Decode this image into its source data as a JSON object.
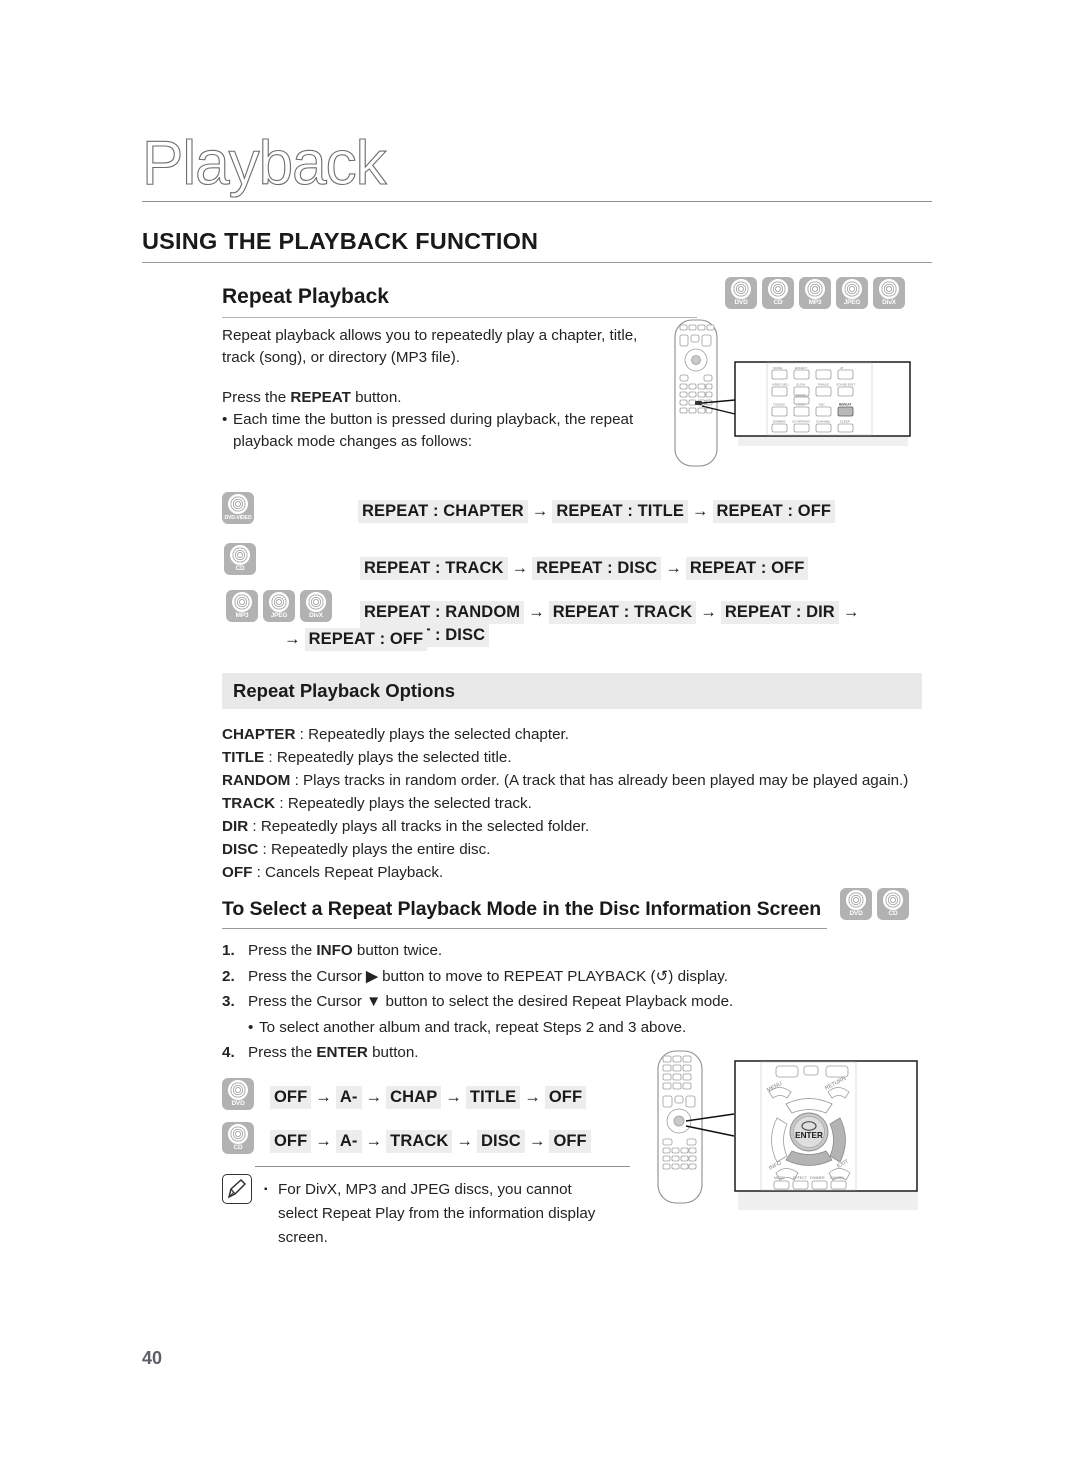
{
  "chapter": {
    "title": "Playback"
  },
  "section": {
    "title": "USING THE PLAYBACK FUNCTION"
  },
  "repeat_playback": {
    "heading": "Repeat Playback",
    "intro_line1": "Repeat playback allows you to repeatedly play a chapter, title,",
    "intro_line2": "track (song), or directory (MP3 file).",
    "press_prefix": "Press the ",
    "press_bold": "REPEAT",
    "press_suffix": " button.",
    "bullet_dot": "•",
    "bullet_line1": "Each time the button is pressed during playback, the repeat",
    "bullet_line2": "playback mode changes as follows:",
    "badges": [
      {
        "label": "DVD",
        "name": "dvd"
      },
      {
        "label": "CD",
        "name": "cd"
      },
      {
        "label": "MP3",
        "name": "mp3"
      },
      {
        "label": "JPEG",
        "name": "jpeg"
      },
      {
        "label": "DivX",
        "name": "divx"
      }
    ]
  },
  "flows": [
    {
      "id": "dvd-video-flow",
      "icons": [
        {
          "label": "DVD-VIDEO",
          "narrow": true
        }
      ],
      "chips": [
        "REPEAT : CHAPTER",
        "REPEAT : TITLE",
        "REPEAT : OFF"
      ],
      "arrow": "→"
    },
    {
      "id": "cd-flow",
      "icons": [
        {
          "label": "CD",
          "narrow": false
        }
      ],
      "chips": [
        "REPEAT : TRACK",
        "REPEAT : DISC",
        "REPEAT : OFF"
      ],
      "arrow": "→"
    },
    {
      "id": "mp3-jpeg-divx-flow",
      "icons": [
        {
          "label": "MP3",
          "narrow": false
        },
        {
          "label": "JPEG",
          "narrow": false
        },
        {
          "label": "DivX",
          "narrow": false
        }
      ],
      "chips": [
        "REPEAT : RANDOM",
        "REPEAT : TRACK",
        "REPEAT : DIR",
        "REPEAT : DISC"
      ],
      "wrap_arrow": "→",
      "wrap_chip": "REPEAT : OFF",
      "arrow": "→"
    }
  ],
  "options": {
    "panel_title": "Repeat Playback Options",
    "items": [
      {
        "term": "CHAPTER",
        "desc": " : Repeatedly plays the selected chapter."
      },
      {
        "term": "TITLE",
        "desc": " : Repeatedly plays the selected title."
      },
      {
        "term": "RANDOM",
        "desc": " : Plays tracks in random order. (A track that has already been played may be played again.)"
      },
      {
        "term": "TRACK",
        "desc": " : Repeatedly plays the selected track."
      },
      {
        "term": "DIR",
        "desc": " : Repeatedly plays all tracks in the selected folder."
      },
      {
        "term": "DISC",
        "desc": " : Repeatedly plays the entire disc."
      },
      {
        "term": "OFF",
        "desc": " : Cancels Repeat Playback."
      }
    ]
  },
  "info_screen": {
    "heading": "To Select a Repeat Playback Mode in the Disc Information Screen",
    "badges": [
      {
        "label": "DVD",
        "name": "dvd"
      },
      {
        "label": "CD",
        "name": "cd"
      }
    ],
    "steps": [
      {
        "num": "1.",
        "pre": "Press the ",
        "bold": "INFO",
        "post": " button twice."
      },
      {
        "num": "2.",
        "pre": "Press the Cursor ",
        "bold": "▶",
        "post": " button to move to REPEAT PLAYBACK (↺) display."
      },
      {
        "num": "3.",
        "pre": "Press the Cursor ",
        "bold": "▼",
        "post": " button to select the desired Repeat Playback mode."
      },
      {
        "num": "4.",
        "pre": "Press the ",
        "bold": "ENTER",
        "post": " button."
      }
    ],
    "substep": {
      "dot": "•",
      "text": "To select another album and track, repeat Steps 2 and 3 above."
    }
  },
  "info_flows": [
    {
      "id": "dvd-info-flow",
      "icons": [
        {
          "label": "DVD",
          "narrow": false
        }
      ],
      "chips": [
        "OFF",
        "A-",
        "CHAP",
        "TITLE",
        "OFF"
      ],
      "arrow": "→"
    },
    {
      "id": "cd-info-flow",
      "icons": [
        {
          "label": "CD",
          "narrow": false
        }
      ],
      "chips": [
        "OFF",
        "A-",
        "TRACK",
        "DISC",
        "OFF"
      ],
      "arrow": "→"
    }
  ],
  "note": {
    "square": "▪",
    "line1": "For DivX, MP3 and JPEG discs, you cannot",
    "line2": "select Repeat Play from the information display",
    "line3": "screen."
  },
  "footer": {
    "page_number": "40"
  },
  "illustration_top": {
    "keys": [
      [
        "MODE",
        "EFFECT",
        "",
        "Ø"
      ],
      [
        "VIDEO SEL.",
        "SLOW",
        "P.BASS",
        "SOUND EDIT"
      ],
      [
        "",
        "MO/ST",
        "",
        ""
      ],
      [
        "TUNING",
        "LOGO",
        "MIC",
        "REPEAT"
      ],
      [
        "DIMMER",
        "CD RIPPING",
        "CHANNEL",
        "SLEEP"
      ]
    ],
    "highlight_key": "REPEAT"
  },
  "illustration_bottom": {
    "labels": [
      "MENU",
      "RETURN",
      "ENTER",
      "INFO",
      "EXIT"
    ],
    "center_label": "ENTER"
  },
  "colors": {
    "chip_bg": "#ededed",
    "badge_bg": "#b2b2b2",
    "panel_bg": "#e9e9e9",
    "page_num": "#5c5f6b"
  }
}
